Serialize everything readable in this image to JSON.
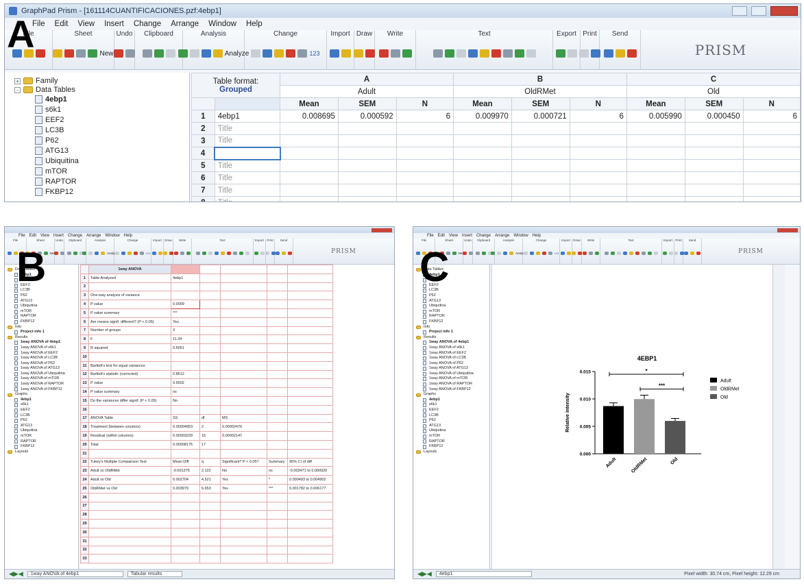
{
  "panel_a": {
    "title": "GraphPad Prism - [161114CUANTIFICACIONES.pzf:4ebp1]",
    "menu": [
      "File",
      "Edit",
      "View",
      "Insert",
      "Change",
      "Arrange",
      "Window",
      "Help"
    ],
    "ribbon_groups": [
      "File",
      "Sheet",
      "Undo",
      "Clipboard",
      "Analysis",
      "Change",
      "Import",
      "Draw",
      "Write",
      "Text",
      "Export",
      "Print",
      "Send"
    ],
    "analyze_label": "Analyze",
    "new_label": "New",
    "num_label": "123",
    "logo": "PRISM",
    "tree": {
      "family": "Family",
      "data_tables": "Data Tables",
      "items": [
        "4ebp1",
        "s6k1",
        "EEF2",
        "LC3B",
        "P62",
        "ATG13",
        "Ubiquitina",
        "mTOR",
        "RAPTOR",
        "FKBP12"
      ]
    },
    "table": {
      "format_label": "Table format:",
      "format_value": "Grouped",
      "columns": [
        {
          "letter": "A",
          "name": "Adult"
        },
        {
          "letter": "B",
          "name": "OldRMet"
        },
        {
          "letter": "C",
          "name": "Old"
        }
      ],
      "subheaders": [
        "Mean",
        "SEM",
        "N"
      ],
      "rows": [
        {
          "num": "1",
          "title": "4ebp1",
          "values": [
            "0.008695",
            "0.000592",
            "6",
            "0.009970",
            "0.000721",
            "6",
            "0.005990",
            "0.000450",
            "6"
          ]
        },
        {
          "num": "2",
          "title": "Title",
          "values": [
            "",
            "",
            "",
            "",
            "",
            "",
            "",
            "",
            ""
          ]
        },
        {
          "num": "3",
          "title": "Title",
          "values": [
            "",
            "",
            "",
            "",
            "",
            "",
            "",
            "",
            ""
          ]
        },
        {
          "num": "4",
          "title": "",
          "values": [
            "",
            "",
            "",
            "",
            "",
            "",
            "",
            "",
            ""
          ]
        },
        {
          "num": "5",
          "title": "Title",
          "values": [
            "",
            "",
            "",
            "",
            "",
            "",
            "",
            "",
            ""
          ]
        },
        {
          "num": "6",
          "title": "Title",
          "values": [
            "",
            "",
            "",
            "",
            "",
            "",
            "",
            "",
            ""
          ]
        },
        {
          "num": "7",
          "title": "Title",
          "values": [
            "",
            "",
            "",
            "",
            "",
            "",
            "",
            "",
            ""
          ]
        },
        {
          "num": "8",
          "title": "Title",
          "values": [
            "",
            "",
            "",
            "",
            "",
            "",
            "",
            "",
            ""
          ]
        }
      ]
    }
  },
  "panel_b": {
    "sheet_title": "1way ANOVA",
    "rows": [
      {
        "n": "1",
        "c": [
          "Table Analyzed",
          "4ebp1",
          "",
          "",
          "",
          ""
        ]
      },
      {
        "n": "2",
        "c": [
          "",
          "",
          "",
          "",
          "",
          ""
        ]
      },
      {
        "n": "3",
        "c": [
          "One-way analysis of variance",
          "",
          "",
          "",
          "",
          ""
        ]
      },
      {
        "n": "4",
        "c": [
          "P value",
          "0.0009",
          "",
          "",
          "",
          ""
        ]
      },
      {
        "n": "5",
        "c": [
          "P value summary",
          "***",
          "",
          "",
          "",
          ""
        ]
      },
      {
        "n": "6",
        "c": [
          "Are means signif. different? (P < 0.05)",
          "Yes",
          "",
          "",
          "",
          ""
        ]
      },
      {
        "n": "7",
        "c": [
          "Number of groups",
          "3",
          "",
          "",
          "",
          ""
        ]
      },
      {
        "n": "8",
        "c": [
          "F",
          "11.34",
          "",
          "",
          "",
          ""
        ]
      },
      {
        "n": "9",
        "c": [
          "R squared",
          "0.6051",
          "",
          "",
          "",
          ""
        ]
      },
      {
        "n": "10",
        "c": [
          "",
          "",
          "",
          "",
          "",
          ""
        ]
      },
      {
        "n": "11",
        "c": [
          "Bartlett's test for equal variances",
          "",
          "",
          "",
          "",
          ""
        ]
      },
      {
        "n": "12",
        "c": [
          "Bartlett's statistic (corrected)",
          "0.8612",
          "",
          "",
          "",
          ""
        ]
      },
      {
        "n": "13",
        "c": [
          "P value",
          "0.6502",
          "",
          "",
          "",
          ""
        ]
      },
      {
        "n": "14",
        "c": [
          "P value summary",
          "ns",
          "",
          "",
          "",
          ""
        ]
      },
      {
        "n": "15",
        "c": [
          "Do the variances differ signif. (P < 0.05)",
          "No",
          "",
          "",
          "",
          ""
        ]
      },
      {
        "n": "16",
        "c": [
          "",
          "",
          "",
          "",
          "",
          ""
        ]
      },
      {
        "n": "17",
        "c": [
          "ANOVA Table",
          "SS",
          "df",
          "MS",
          "",
          ""
        ]
      },
      {
        "n": "18",
        "c": [
          "Treatment (between columns)",
          "0.00004953",
          "2",
          "0.00002476",
          "",
          ""
        ]
      },
      {
        "n": "19",
        "c": [
          "Residual (within columns)",
          "0.00003229",
          "15",
          "0.00002147",
          "",
          ""
        ]
      },
      {
        "n": "20",
        "c": [
          "Total",
          "0.00008175",
          "17",
          "",
          "",
          ""
        ]
      },
      {
        "n": "21",
        "c": [
          "",
          "",
          "",
          "",
          "",
          ""
        ]
      },
      {
        "n": "22",
        "c": [
          "Tukey's Multiple Comparison Test",
          "Mean Diff",
          "q",
          "Significant? P < 0.05?",
          "Summary",
          "95% CI of diff"
        ]
      },
      {
        "n": "23",
        "c": [
          "Adult vs OldRMet",
          "-0.001275",
          "2.122",
          "No",
          "ns",
          "-0.003471 to 0.000920"
        ]
      },
      {
        "n": "24",
        "c": [
          "Adult vs Old",
          "0.002704",
          "4.521",
          "Yes",
          "*",
          "0.000493 to 0.004902"
        ]
      },
      {
        "n": "25",
        "c": [
          "OldRMet vs Old",
          "0.003979",
          "6.653",
          "Yes",
          "***",
          "0.001782 to 0.006177"
        ]
      },
      {
        "n": "26",
        "c": [
          "",
          "",
          "",
          "",
          "",
          ""
        ]
      },
      {
        "n": "27",
        "c": [
          "",
          "",
          "",
          "",
          "",
          ""
        ]
      },
      {
        "n": "28",
        "c": [
          "",
          "",
          "",
          "",
          "",
          ""
        ]
      },
      {
        "n": "29",
        "c": [
          "",
          "",
          "",
          "",
          "",
          ""
        ]
      },
      {
        "n": "30",
        "c": [
          "",
          "",
          "",
          "",
          "",
          ""
        ]
      },
      {
        "n": "31",
        "c": [
          "",
          "",
          "",
          "",
          "",
          ""
        ]
      },
      {
        "n": "32",
        "c": [
          "",
          "",
          "",
          "",
          "",
          ""
        ]
      },
      {
        "n": "33",
        "c": [
          "",
          "",
          "",
          "",
          "",
          ""
        ]
      }
    ],
    "tree": {
      "data_tables": "Data Tables",
      "data_items": [
        "4ebp1",
        "s6k1",
        "EEF2",
        "LC3B",
        "P62",
        "ATG13",
        "Ubiquitina",
        "mTOR",
        "RAPTOR",
        "FKBP12"
      ],
      "info": "Info",
      "info_items": [
        "Project info 1"
      ],
      "results": "Results",
      "result_items": [
        "1way ANOVA of 4ebp1",
        "1way ANOVA of s6k1",
        "1way ANOVA of EEF2",
        "1way ANOVA of LC3B",
        "1way ANOVA of P62",
        "1way ANOVA of ATG13",
        "1way ANOVA of Ubiquitina",
        "1way ANOVA of mTOR",
        "1way ANOVA of RAPTOR",
        "1way ANOVA of FKBP12"
      ],
      "graphs": "Graphs",
      "graph_items": [
        "4ebp1",
        "s6k1",
        "EEF2",
        "LC3B",
        "P62",
        "ATG13",
        "Ubiquitina",
        "mTOR",
        "RAPTOR",
        "FKBP12"
      ],
      "layouts": "Layouts"
    },
    "status_sheet": "1way ANOVA of 4ebp1",
    "status_view": "Tabular results"
  },
  "panel_c": {
    "status_sheet": "4ebp1",
    "status_right": "Pixel width: 30.74 cm, Pixel height: 12.29 cm"
  },
  "chart_data": {
    "type": "bar",
    "title": "4EBP1",
    "ylabel": "Relative intensity",
    "categories": [
      "Adult",
      "OldRMet",
      "Old"
    ],
    "values": [
      0.008695,
      0.00997,
      0.00599
    ],
    "errors": [
      0.000592,
      0.000721,
      0.00045
    ],
    "colors": [
      "#000000",
      "#999999",
      "#555555"
    ],
    "ylim": [
      0,
      0.015
    ],
    "yticks": [
      "0.000",
      "0.005",
      "0.010",
      "0.015"
    ],
    "legend": [
      "Adult",
      "OldRMet",
      "Old"
    ],
    "legend_position": "right",
    "significance": [
      {
        "from": "Adult",
        "to": "Old",
        "label": "*"
      },
      {
        "from": "OldRMet",
        "to": "Old",
        "label": "***"
      }
    ]
  },
  "labels": {
    "a": "A",
    "b": "B",
    "c": "C"
  }
}
